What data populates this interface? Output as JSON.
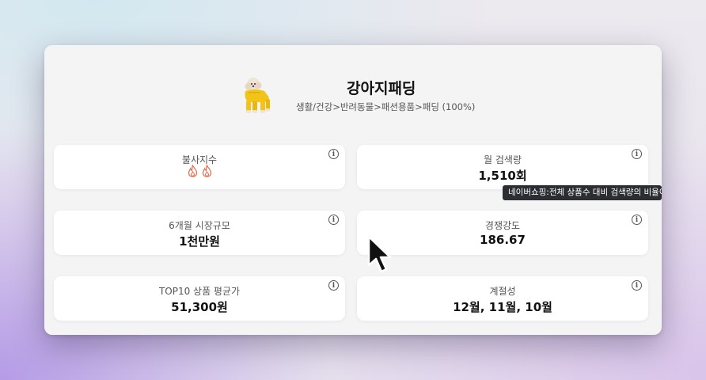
{
  "product": {
    "title": "강아지패딩",
    "category": "생활/건강>반려동물>패션용품>패딩 (100%)"
  },
  "cards": [
    {
      "label": "불사지수",
      "value": "",
      "icon": "fire-icon"
    },
    {
      "label": "월 검색량",
      "value": "1,510회"
    },
    {
      "label": "6개월 시장규모",
      "value": "1천만원"
    },
    {
      "label": "경쟁강도",
      "value": "186.67"
    },
    {
      "label": "TOP10 상품 평균가",
      "value": "51,300원"
    },
    {
      "label": "계절성",
      "value": "12월, 11월, 10월"
    }
  ],
  "info_icon_glyph": "i",
  "tooltip": "네이버쇼핑:전체 상품수 대비 검색량의 비율이",
  "colors": {
    "tooltip_bg": "#2b2d33",
    "fire": "#e8694a"
  }
}
